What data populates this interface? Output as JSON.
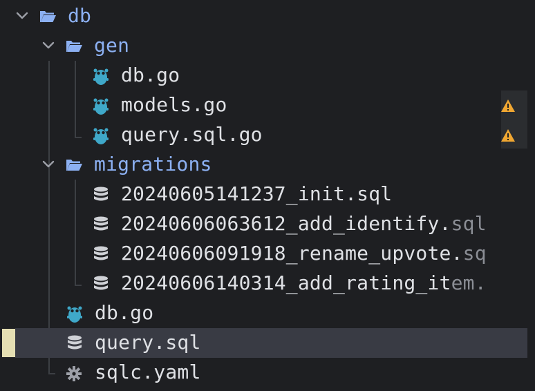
{
  "tree": {
    "db_folder": {
      "label": "db"
    },
    "gen_folder": {
      "label": "gen"
    },
    "gen_files": [
      {
        "label": "db.go",
        "icon": "gopher-icon"
      },
      {
        "label": "models.go",
        "icon": "gopher-icon",
        "warning": true
      },
      {
        "label": "query.sql.go",
        "icon": "gopher-icon",
        "warning": true
      }
    ],
    "migrations_folder": {
      "label": "migrations"
    },
    "migration_files": [
      {
        "label": "20240605141237_init.sql",
        "dim": ""
      },
      {
        "label": "20240606063612_add_identify.",
        "dim": "sql"
      },
      {
        "label": "20240606091918_rename_upvote.",
        "dim": "sq"
      },
      {
        "label": "20240606140314_add_rating_it",
        "dim": "em."
      }
    ],
    "db_files": [
      {
        "label": "db.go",
        "icon": "gopher-icon"
      },
      {
        "label": "query.sql",
        "icon": "database-icon",
        "selected": true
      },
      {
        "label": "sqlc.yaml",
        "icon": "gear-icon"
      }
    ]
  },
  "colors": {
    "background": "#1e1f22",
    "folder_text": "#8cb0f2",
    "file_text": "#dfe1e5",
    "selection": "#393b44",
    "warning": "#f0a732",
    "gopher": "#3fa8c9"
  }
}
